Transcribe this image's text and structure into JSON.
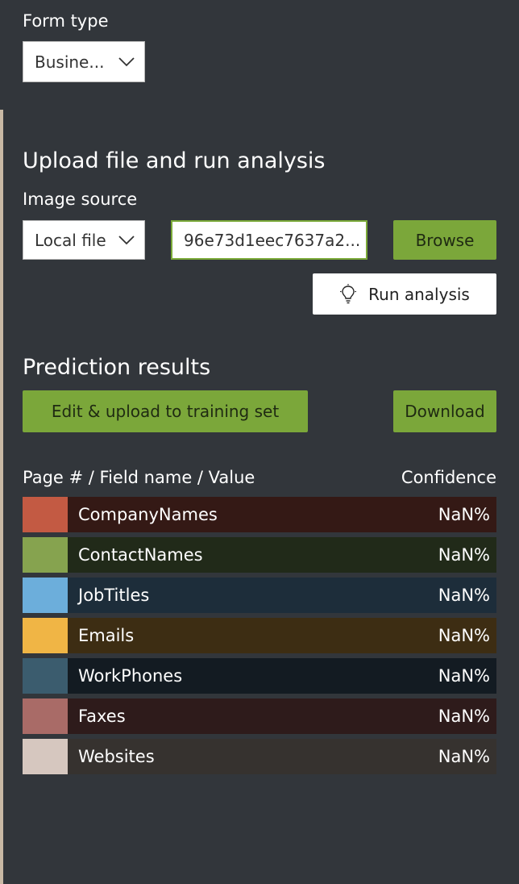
{
  "form_type": {
    "label": "Form type",
    "selected": "Busine..."
  },
  "upload": {
    "heading": "Upload file and run analysis",
    "image_source_label": "Image source",
    "image_source_selected": "Local file",
    "file_value": "96e73d1eec7637a2...",
    "browse_label": "Browse",
    "run_label": "Run analysis"
  },
  "prediction": {
    "heading": "Prediction results",
    "edit_upload_label": "Edit & upload to training set",
    "download_label": "Download",
    "col_field": "Page # / Field name / Value",
    "col_confidence": "Confidence",
    "rows": [
      {
        "name": "CompanyNames",
        "confidence": "NaN%",
        "swatch": "#c35a43",
        "bg": "#341915"
      },
      {
        "name": "ContactNames",
        "confidence": "NaN%",
        "swatch": "#86a34f",
        "bg": "#212a19"
      },
      {
        "name": "JobTitles",
        "confidence": "NaN%",
        "swatch": "#6caedb",
        "bg": "#1d2d3a"
      },
      {
        "name": "Emails",
        "confidence": "NaN%",
        "swatch": "#f0b545",
        "bg": "#3d2d13"
      },
      {
        "name": "WorkPhones",
        "confidence": "NaN%",
        "swatch": "#3b5c6e",
        "bg": "#131b22"
      },
      {
        "name": "Faxes",
        "confidence": "NaN%",
        "swatch": "#a96b67",
        "bg": "#2e1b1b"
      },
      {
        "name": "Websites",
        "confidence": "NaN%",
        "swatch": "#d6c7bf",
        "bg": "#36322f"
      }
    ]
  }
}
